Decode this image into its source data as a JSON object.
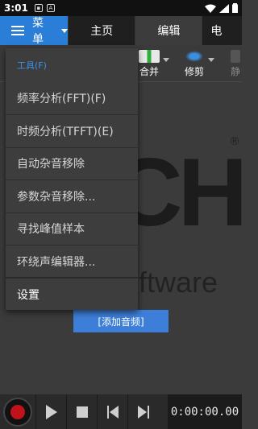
{
  "status_bar": {
    "time": "3:01",
    "icons": [
      "sim-icon",
      "notification-icon",
      "wifi-icon",
      "signal-icon",
      "battery-icon"
    ]
  },
  "top_bar": {
    "menu_label": "菜单",
    "tabs": [
      {
        "label": "主页",
        "active": false
      },
      {
        "label": "编辑",
        "active": true
      },
      {
        "label": "电",
        "active": false
      }
    ]
  },
  "toolbar": {
    "merge_label": "合并",
    "trim_label": "修剪",
    "partial_label": "静"
  },
  "dropdown": {
    "section_title": "工具(F)",
    "items": [
      "频率分析(FFT)(F)",
      "时频分析(TFFT)(E)",
      "自动杂音移除",
      "参数杂音移除...",
      "寻找峰值样本",
      "环绕声编辑器...",
      "设置"
    ]
  },
  "background": {
    "logo_letters": "CH",
    "reg_mark": "®",
    "brand_fragment": "ftware",
    "add_audio_label": "[添加音频]"
  },
  "transport": {
    "time_display": "0:00:00.00"
  },
  "colors": {
    "accent": "#2b7ed8",
    "record": "#c1121a",
    "section_title": "#3d8fe8"
  }
}
